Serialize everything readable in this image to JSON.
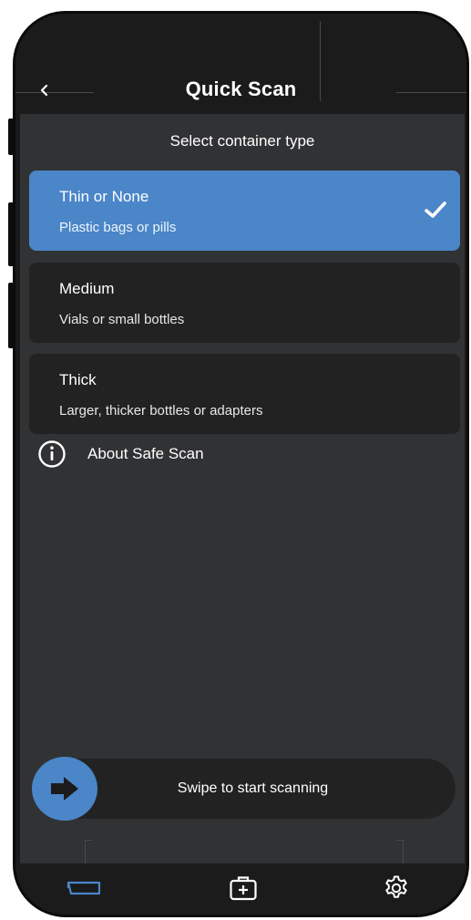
{
  "header": {
    "title": "Quick Scan",
    "back_icon": "chevron-left-icon"
  },
  "main": {
    "subtitle": "Select container type",
    "options": [
      {
        "title": "Thin or None",
        "subtitle": "Plastic bags or pills",
        "selected": true
      },
      {
        "title": "Medium",
        "subtitle": "Vials or small bottles",
        "selected": false
      },
      {
        "title": "Thick",
        "subtitle": "Larger, thicker bottles or adapters",
        "selected": false
      }
    ],
    "about_label": "About Safe Scan",
    "about_icon": "info-icon"
  },
  "swipe": {
    "label": "Swipe to start scanning",
    "icon": "arrow-right-icon"
  },
  "bottom_nav": {
    "items": [
      {
        "icon": "scan-tab-icon",
        "active": true
      },
      {
        "icon": "medical-kit-icon",
        "active": false
      },
      {
        "icon": "gear-icon",
        "active": false
      }
    ]
  },
  "colors": {
    "accent": "#4a86c8",
    "background": "#313234",
    "card": "#222223",
    "bar": "#1b1b1c"
  }
}
